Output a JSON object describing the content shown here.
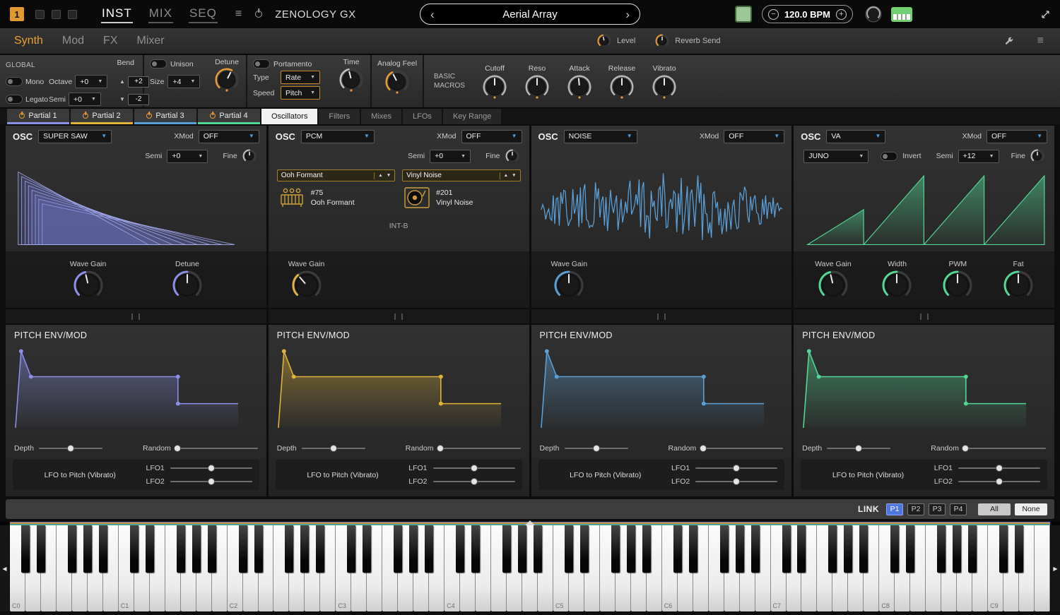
{
  "icons": {
    "tri_down": "▼",
    "tri_up": "▲",
    "chevron_left": "‹",
    "chevron_right": "›",
    "menu": "≡",
    "minus": "−",
    "plus": "+",
    "scroll_left": "◀",
    "scroll_right": "▶"
  },
  "colors": {
    "accent_orange": "#e89a38",
    "partial_1": "#8a8fe8",
    "partial_2": "#e0b23c",
    "partial_3": "#5aa0d8",
    "partial_4": "#52d894",
    "dropdown_arrow": "#4aa0e8",
    "link_active": "#5276e0"
  },
  "titlebar": {
    "slot_number": "1",
    "mode_tabs": [
      "INST",
      "MIX",
      "SEQ"
    ],
    "app_title": "ZENOLOGY GX",
    "patch_name": "Aerial Array",
    "bpm_value": "120.0 BPM"
  },
  "navbar": {
    "tabs": [
      "Synth",
      "Mod",
      "FX",
      "Mixer"
    ],
    "active_tab": "Synth",
    "level_label": "Level",
    "reverb_send_label": "Reverb Send"
  },
  "global": {
    "title": "GLOBAL",
    "mono_label": "Mono",
    "legato_label": "Legato",
    "octave_label": "Octave",
    "octave_value": "+0",
    "semi_label": "Semi",
    "semi_value": "+0",
    "bend_label": "Bend",
    "bend_up_value": "+2",
    "bend_down_value": "-2",
    "unison_label": "Unison",
    "unison_size_label": "Size",
    "unison_size_value": "+4",
    "unison_detune_label": "Detune",
    "portamento_label": "Portamento",
    "portamento_type_label": "Type",
    "portamento_type_value": "Rate",
    "portamento_speed_label": "Speed",
    "portamento_speed_value": "Pitch",
    "portamento_time_label": "Time",
    "analog_feel_label": "Analog Feel",
    "basic_macros_label": "BASIC MACROS",
    "macro_labels": [
      "Cutoff",
      "Reso",
      "Attack",
      "Release",
      "Vibrato"
    ]
  },
  "partial_tabs": {
    "partials": [
      {
        "label": "Partial 1"
      },
      {
        "label": "Partial 2"
      },
      {
        "label": "Partial 3"
      },
      {
        "label": "Partial 4"
      }
    ],
    "sections": [
      "Oscillators",
      "Filters",
      "Mixes",
      "LFOs",
      "Key Range"
    ],
    "active_section": "Oscillators"
  },
  "osc": {
    "osc_label": "OSC",
    "xmod_label": "XMod",
    "semi_label": "Semi",
    "fine_label": "Fine",
    "partials": [
      {
        "type": "SUPER SAW",
        "xmod": "OFF",
        "semi": "+0",
        "knobs": [
          "Wave Gain",
          "Detune"
        ]
      },
      {
        "type": "PCM",
        "xmod": "OFF",
        "semi": "+0",
        "slot_a_id": "#75",
        "slot_a_name": "Ooh Formant",
        "slot_b_id": "#201",
        "slot_b_name": "Vinyl Noise",
        "bank": "INT-B",
        "knobs": [
          "Wave Gain"
        ]
      },
      {
        "type": "NOISE",
        "xmod": "OFF",
        "knobs": [
          "Wave Gain"
        ]
      },
      {
        "type": "VA",
        "xmod": "OFF",
        "va_model": "JUNO",
        "invert_label": "Invert",
        "semi": "+12",
        "knobs": [
          "Wave Gain",
          "Width",
          "PWM",
          "Fat"
        ]
      }
    ]
  },
  "pitch_env": {
    "title": "PITCH ENV/MOD",
    "depth_label": "Depth",
    "random_label": "Random",
    "lfo_caption": "LFO to Pitch (Vibrato)",
    "lfo1_label": "LFO1",
    "lfo2_label": "LFO2",
    "depth_pct": 50,
    "random_pct": 2,
    "lfo1_pct": 50,
    "lfo2_pct": 50
  },
  "link_bar": {
    "label": "LINK",
    "partial_buttons": [
      "P1",
      "P2",
      "P3",
      "P4"
    ],
    "active": "P1",
    "all_label": "All",
    "none_label": "None"
  },
  "keyboard": {
    "octave_labels": [
      "C0",
      "C1",
      "C2",
      "C3",
      "C4",
      "C5",
      "C6",
      "C7",
      "C8",
      "C9"
    ]
  }
}
